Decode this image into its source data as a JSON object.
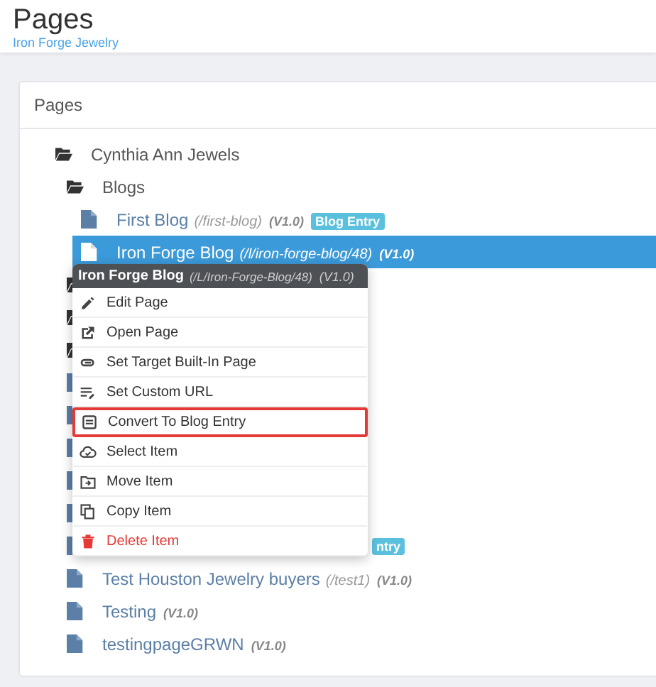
{
  "header": {
    "title": "Pages",
    "subtitle": "Iron Forge Jewelry"
  },
  "card": {
    "title": "Pages"
  },
  "tree": [
    {
      "kind": "folder",
      "label": "Cynthia Ann Jewels",
      "selected": false,
      "children": [
        {
          "kind": "folder",
          "label": "Blogs",
          "selected": false,
          "children": [
            {
              "kind": "page",
              "label": "First Blog",
              "path": "(/first-blog)",
              "version": "(V1.0)",
              "badge": "Blog Entry",
              "selected": false
            },
            {
              "kind": "page",
              "label": "Iron Forge Blog",
              "path": "(/l/iron-forge-blog/48)",
              "version": "(V1.0)",
              "selected": true
            }
          ]
        },
        {
          "kind": "folder",
          "selected": false
        },
        {
          "kind": "folder",
          "selected": false
        },
        {
          "kind": "folder",
          "selected": false
        },
        {
          "kind": "page",
          "selected": false
        },
        {
          "kind": "page",
          "selected": false
        },
        {
          "kind": "page",
          "selected": false
        },
        {
          "kind": "page",
          "selected": false
        },
        {
          "kind": "page",
          "selected": false
        },
        {
          "kind": "page",
          "badge": "ntry",
          "selected": false
        },
        {
          "kind": "page",
          "label": "Test Houston Jewelry buyers",
          "path": "(/test1)",
          "version": "(V1.0)",
          "selected": false
        },
        {
          "kind": "page",
          "label": "Testing",
          "version": "(V1.0)",
          "selected": false
        },
        {
          "kind": "page",
          "label": "testingpageGRWN",
          "version": "(V1.0)",
          "selected": false
        }
      ]
    }
  ],
  "context_menu": {
    "title": "Iron Forge Blog",
    "path": "(/L/Iron-Forge-Blog/48)",
    "version": "(V1.0)",
    "items": [
      {
        "kind": "edit",
        "label": "Edit Page",
        "highlighted": false
      },
      {
        "kind": "open",
        "label": "Open Page",
        "highlighted": false
      },
      {
        "kind": "link",
        "label": "Set Target Built-In Page",
        "highlighted": false
      },
      {
        "kind": "url",
        "label": "Set Custom URL",
        "highlighted": false
      },
      {
        "kind": "convert",
        "label": "Convert To Blog Entry",
        "highlighted": true
      },
      {
        "kind": "select",
        "label": "Select Item",
        "highlighted": false
      },
      {
        "kind": "move",
        "label": "Move Item",
        "highlighted": false
      },
      {
        "kind": "copy",
        "label": "Copy Item",
        "highlighted": false
      },
      {
        "kind": "delete",
        "label": "Delete Item",
        "highlighted": false
      }
    ]
  }
}
